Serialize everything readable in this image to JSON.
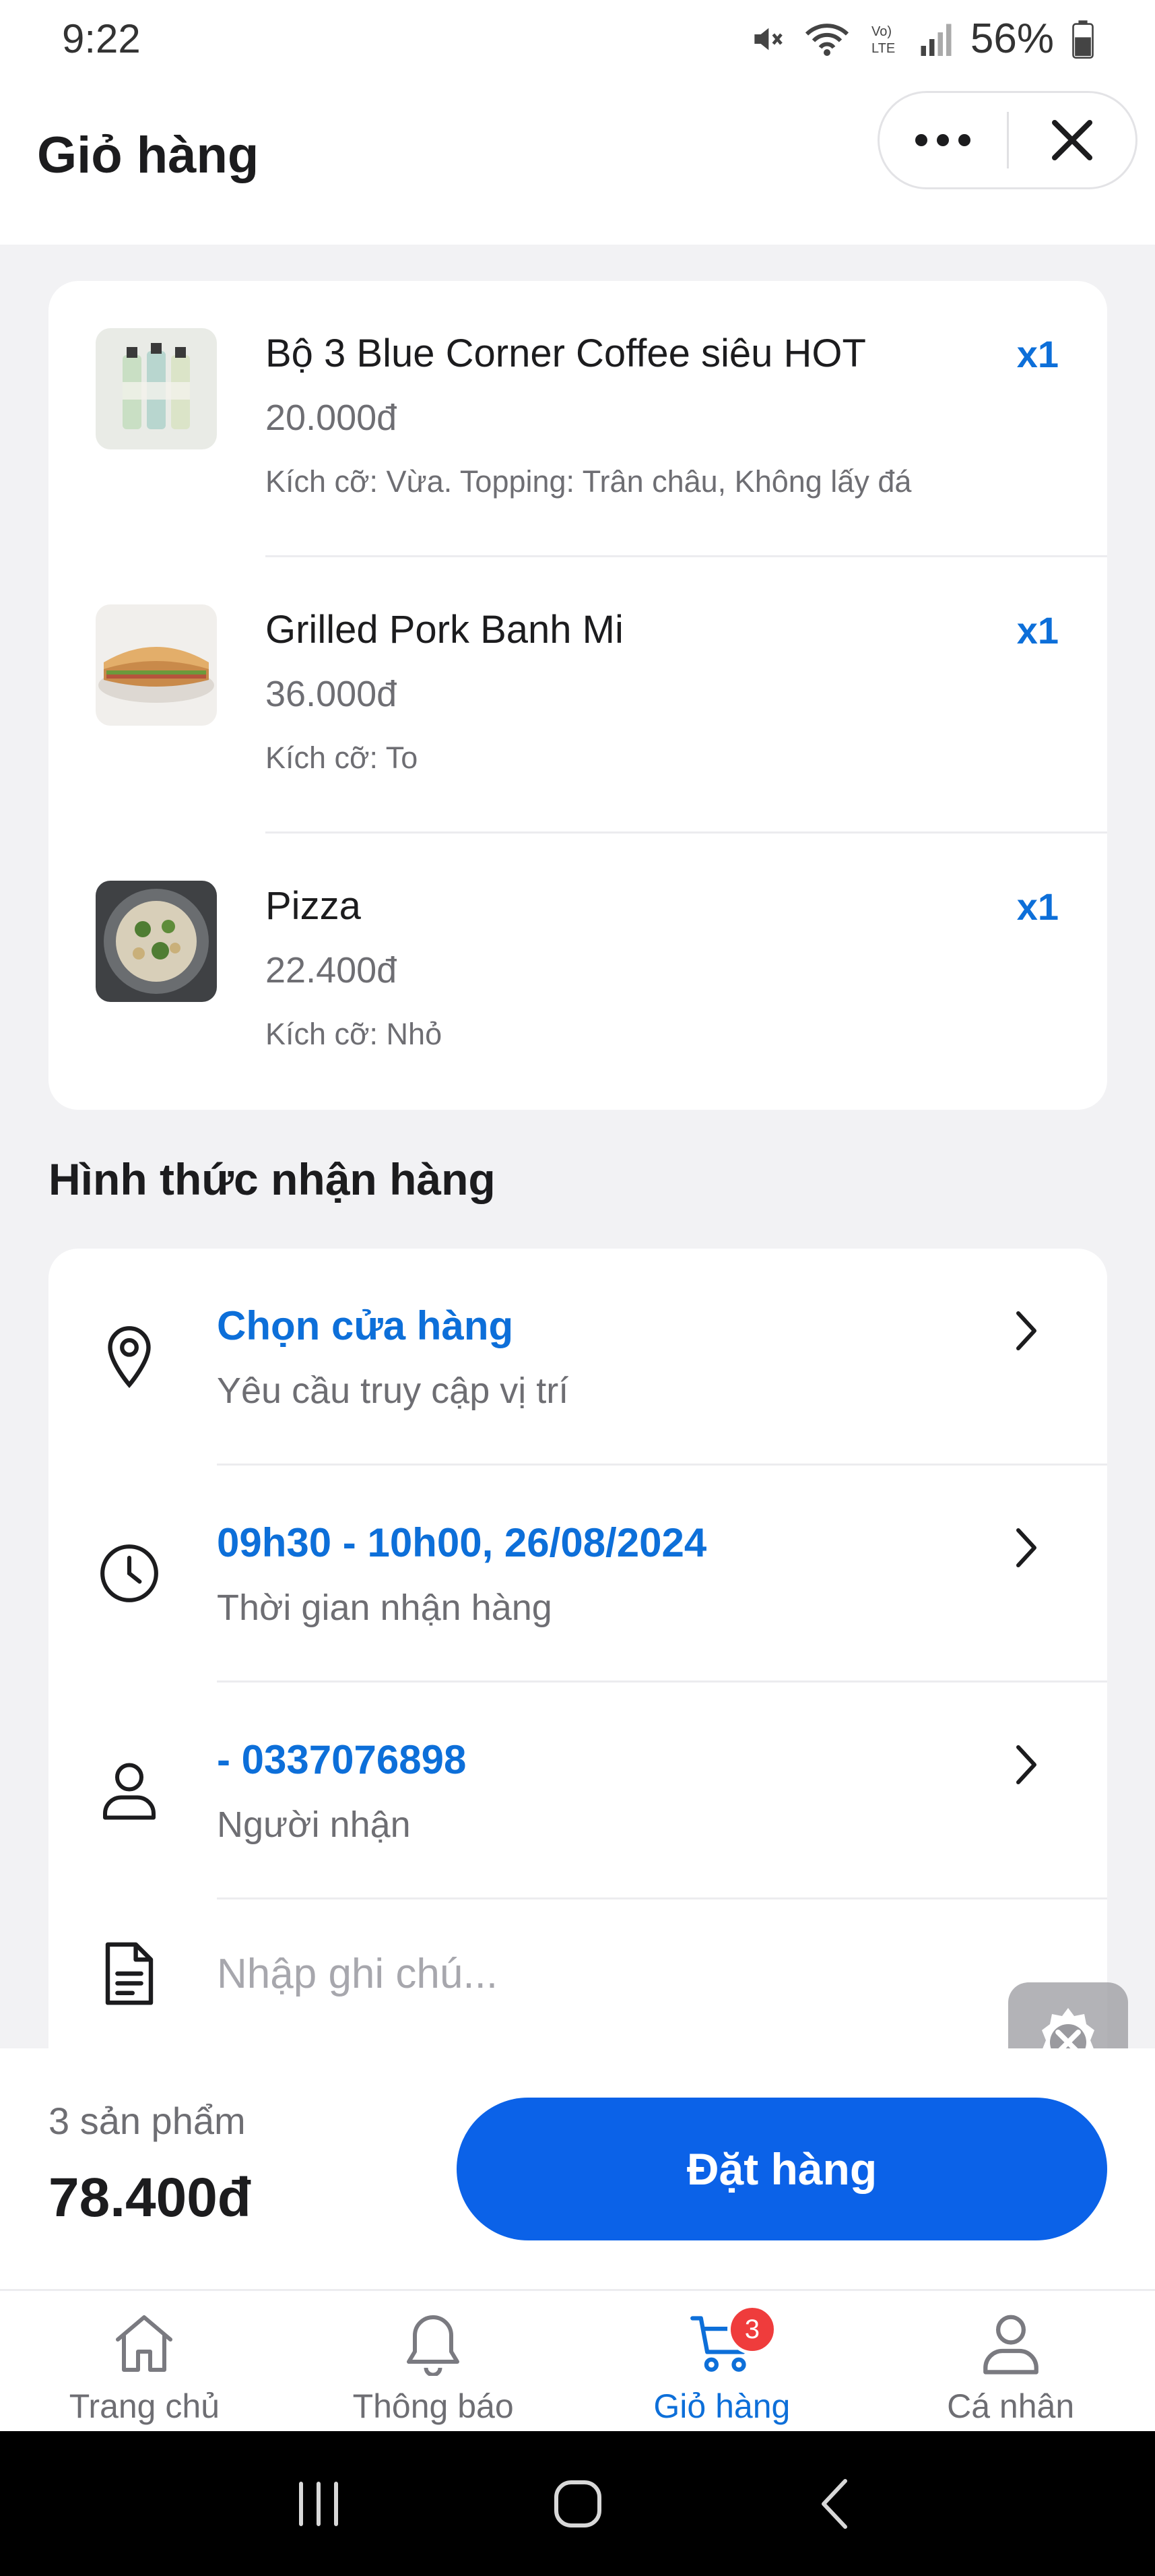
{
  "status_bar": {
    "time": "9:22",
    "battery": "56%"
  },
  "header": {
    "title": "Giỏ hàng"
  },
  "cart_items": [
    {
      "name": "Bộ 3 Blue Corner Coffee siêu HOT",
      "price": "20.000đ",
      "options": "Kích cỡ: Vừa. Topping: Trân châu, Không lấy đá",
      "quantity": "x1",
      "image": "coffee-bottles-thumbnail"
    },
    {
      "name": "Grilled Pork Banh Mi",
      "price": "36.000đ",
      "options": "Kích cỡ: To",
      "quantity": "x1",
      "image": "banh-mi-thumbnail"
    },
    {
      "name": "Pizza",
      "price": "22.400đ",
      "options": "Kích cỡ: Nhỏ",
      "quantity": "x1",
      "image": "pizza-thumbnail"
    }
  ],
  "delivery": {
    "section_title": "Hình thức nhận hàng",
    "store": {
      "primary": "Chọn cửa hàng",
      "secondary": "Yêu cầu truy cập vị trí",
      "icon": "location-pin-icon"
    },
    "time": {
      "primary": "09h30 - 10h00, 26/08/2024",
      "secondary": "Thời gian nhận hàng",
      "icon": "clock-icon"
    },
    "recipient": {
      "primary": "- 0337076898",
      "secondary": "Người nhận",
      "icon": "person-icon"
    },
    "note": {
      "placeholder": "Nhập ghi chú...",
      "value": "",
      "icon": "document-icon"
    }
  },
  "checkout": {
    "count": "3 sản phẩm",
    "total": "78.400đ",
    "order_button": "Đặt hàng"
  },
  "tabbar": [
    {
      "label": "Trang chủ",
      "icon": "home-icon",
      "active": false
    },
    {
      "label": "Thông báo",
      "icon": "bell-icon",
      "active": false
    },
    {
      "label": "Giỏ hàng",
      "icon": "cart-icon",
      "active": true,
      "badge": "3"
    },
    {
      "label": "Cá nhân",
      "icon": "profile-icon",
      "active": false
    }
  ],
  "colors": {
    "accent": "#0d6fd9",
    "button": "#0b62e8",
    "badge": "#ef3c3c"
  }
}
